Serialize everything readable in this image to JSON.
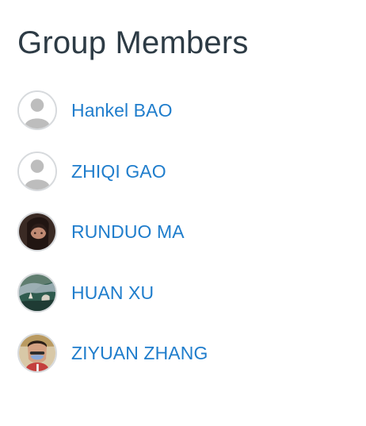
{
  "section": {
    "title": "Group Members"
  },
  "members": [
    {
      "name": "Hankel BAO",
      "avatar": "default-person-icon"
    },
    {
      "name": "ZHIQI GAO",
      "avatar": "default-person-icon"
    },
    {
      "name": "RUNDUO MA",
      "avatar": "photo-portrait"
    },
    {
      "name": "HUAN XU",
      "avatar": "photo-scenery"
    },
    {
      "name": "ZIYUAN ZHANG",
      "avatar": "photo-masked-portrait"
    }
  ],
  "colors": {
    "title": "#2d3b45",
    "link": "#1f7dcc",
    "avatar_border": "#d7dadd"
  }
}
